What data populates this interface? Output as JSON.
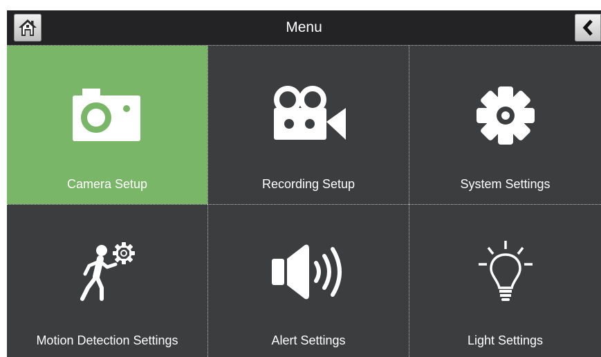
{
  "header": {
    "title": "Menu",
    "home_icon": "home-icon",
    "back_icon": "chevron-left-icon"
  },
  "colors": {
    "background": "#3c3d3f",
    "header": "#232325",
    "selected_tile": "#7ab668",
    "text": "#ffffff"
  },
  "menu": {
    "selected": "Camera Setup",
    "items": [
      {
        "label": "Camera Setup",
        "icon": "camera-icon"
      },
      {
        "label": "Recording Setup",
        "icon": "video-camera-icon"
      },
      {
        "label": "System Settings",
        "icon": "gear-icon"
      },
      {
        "label": "Motion Detection Settings",
        "icon": "motion-detection-icon"
      },
      {
        "label": "Alert Settings",
        "icon": "speaker-icon"
      },
      {
        "label": "Light Settings",
        "icon": "light-bulb-icon"
      }
    ]
  }
}
